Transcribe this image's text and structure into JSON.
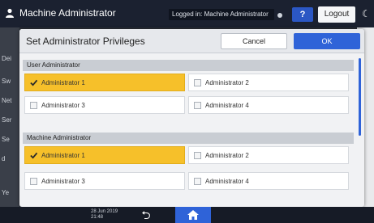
{
  "topbar": {
    "title": "Machine Administrator",
    "logged_in": "Logged in: Machine Administrator",
    "help_label": "?",
    "logout_label": "Logout"
  },
  "background": {
    "sidebar_labels": [
      "Dei",
      "Sw",
      "Net",
      "Ser",
      "Se",
      "d",
      "Ye"
    ]
  },
  "dialog": {
    "title": "Set Administrator Privileges",
    "cancel_label": "Cancel",
    "ok_label": "OK",
    "sections": [
      {
        "title": "User Administrator",
        "options": [
          {
            "label": "Administrator 1",
            "checked": true
          },
          {
            "label": "Administrator 2",
            "checked": false
          },
          {
            "label": "Administrator 3",
            "checked": false
          },
          {
            "label": "Administrator 4",
            "checked": false
          }
        ]
      },
      {
        "title": "Machine Administrator",
        "options": [
          {
            "label": "Administrator 1",
            "checked": true
          },
          {
            "label": "Administrator 2",
            "checked": false
          },
          {
            "label": "Administrator 3",
            "checked": false
          },
          {
            "label": "Administrator 4",
            "checked": false
          }
        ]
      }
    ]
  },
  "bottombar": {
    "date": "28 Jun 2019",
    "time": "21:48"
  },
  "colors": {
    "selected": "#f6c02a",
    "accent": "#2f63d8"
  }
}
